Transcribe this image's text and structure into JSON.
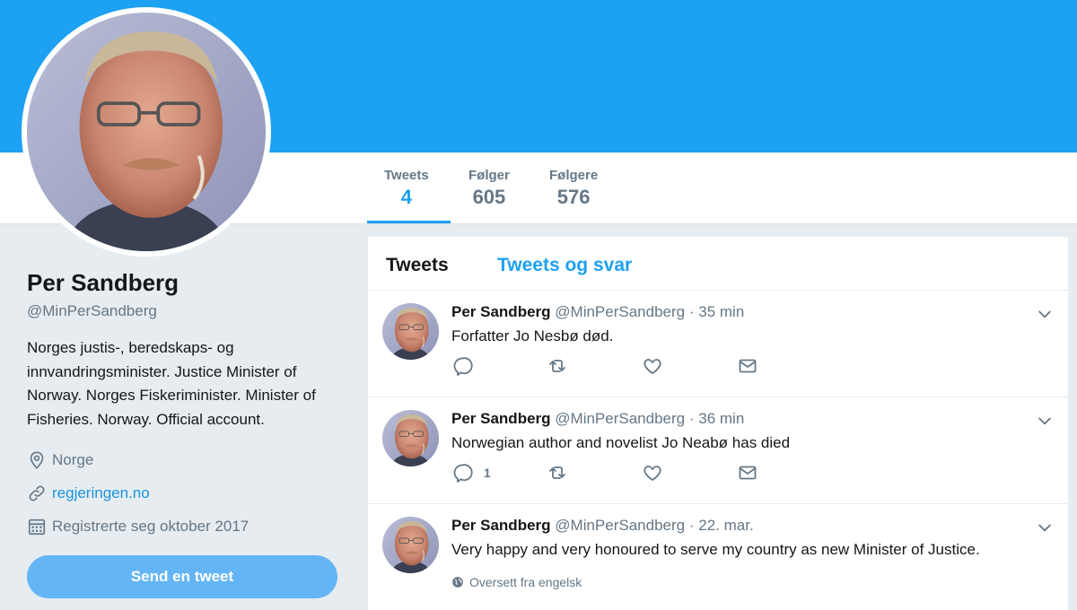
{
  "profile": {
    "name": "Per Sandberg",
    "handle": "@MinPerSandberg",
    "bio": "Norges justis-, beredskaps- og innvandringsminister. Justice Minister of Norway. Norges Fiskeriminister. Minister of Fisheries. Norway. Official account.",
    "location": "Norge",
    "website": "regjeringen.no",
    "joined": "Registrerte seg oktober 2017",
    "tweet_button": "Send en tweet"
  },
  "stats": [
    {
      "label": "Tweets",
      "value": "4",
      "active": true
    },
    {
      "label": "Følger",
      "value": "605",
      "active": false
    },
    {
      "label": "Følgere",
      "value": "576",
      "active": false
    }
  ],
  "timeline_tabs": [
    "Tweets",
    "Tweets og svar"
  ],
  "tweets": [
    {
      "name": "Per Sandberg",
      "handle": "@MinPerSandberg",
      "time": "· 35 min",
      "text": "Forfatter Jo Nesbø død.",
      "reply_count": ""
    },
    {
      "name": "Per Sandberg",
      "handle": "@MinPerSandberg",
      "time": "· 36 min",
      "text": "Norwegian author and novelist Jo Neabø has died",
      "reply_count": "1"
    },
    {
      "name": "Per Sandberg",
      "handle": "@MinPerSandberg",
      "time": "· 22. mar.",
      "text": "Very happy and very honoured to serve my country as new Minister of Justice.",
      "translate": "Oversett fra engelsk"
    }
  ],
  "colors": {
    "brand": "#1da1f2",
    "button": "#64b5f6",
    "muted": "#657786",
    "background": "#e6ecf0"
  },
  "icons": [
    "location-icon",
    "link-icon",
    "calendar-icon",
    "reply-icon",
    "retweet-icon",
    "like-icon",
    "message-icon",
    "chevron-down-icon",
    "globe-icon"
  ]
}
